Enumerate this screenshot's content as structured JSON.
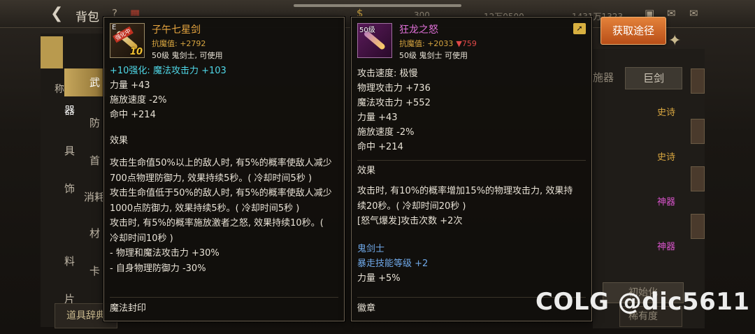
{
  "topbar": {
    "title": "背包",
    "gold_value": "300",
    "currency1": "12万0500",
    "currency2": "1431万1323"
  },
  "left_menu": {
    "items": [
      {
        "label": "武器",
        "active": true
      },
      {
        "label": "防具"
      },
      {
        "label": "首饰"
      },
      {
        "label": "消耗"
      },
      {
        "label": "材料"
      },
      {
        "label": "卡片"
      }
    ],
    "partial_label": "称",
    "dict_button": "道具辞典"
  },
  "right_panel": {
    "tab_prev": "施器",
    "tab_active": "巨剑",
    "rarities": [
      {
        "label": "史诗",
        "kind": "epic"
      },
      {
        "label": "史诗",
        "kind": "epic"
      },
      {
        "label": "神器",
        "kind": "myth"
      },
      {
        "label": "神器",
        "kind": "myth"
      }
    ],
    "sort_button": "初始化",
    "sort_select": "稀有度"
  },
  "obtain_button": "获取途径",
  "watermark": "COLG @dic5611",
  "left_item": {
    "icon_level": "E",
    "icon_badge": "强化中",
    "icon_plus": "10",
    "name": "子午七星剑",
    "anti_magic": "抗魔值: +2792",
    "requirement": "50级 鬼剑士, 可使用",
    "enhance_line": "+10强化: 魔法攻击力 +103",
    "stats": [
      "力量 +43",
      "施放速度 -2%",
      "命中 +214"
    ],
    "effect_title": "效果",
    "effects": [
      "攻击生命值50%以上的敌人时, 有5%的概率使敌人减少",
      "700点物理防御力, 效果持续5秒。( 冷却时间5秒 )",
      "攻击生命值低于50%的敌人时, 有5%的概率使敌人减少",
      "1000点防御力, 效果持续5秒。( 冷却时间5秒 )",
      "攻击时, 有5%的概率施放激者之怒, 效果持续10秒。(",
      "冷却时间10秒 )",
      " - 物理和魔法攻击力 +30%",
      " - 自身物理防御力 -30%"
    ],
    "footer": "魔法封印"
  },
  "right_item": {
    "icon_level": "50级",
    "name": "狂龙之怒",
    "anti_magic": "抗魔值: +2033",
    "anti_magic_diff": "▼759",
    "requirement": "50级 鬼剑士 可使用",
    "stats": [
      "攻击速度: 极慢",
      "物理攻击力 +736",
      "魔法攻击力 +552",
      "力量 +43",
      "施放速度 -2%",
      "命中 +214"
    ],
    "effect_title": "效果",
    "effects": [
      "攻击时, 有10%的概率增加15%的物理攻击力, 效果持",
      "续20秒。( 冷却时间20秒 )",
      "[怒气爆发]攻击次数 +2次"
    ],
    "class_label": "鬼剑士",
    "skill_label": "暴走技能等级",
    "skill_value": "+2",
    "extra_stat": "力量 +5%",
    "footer": "徽章"
  }
}
